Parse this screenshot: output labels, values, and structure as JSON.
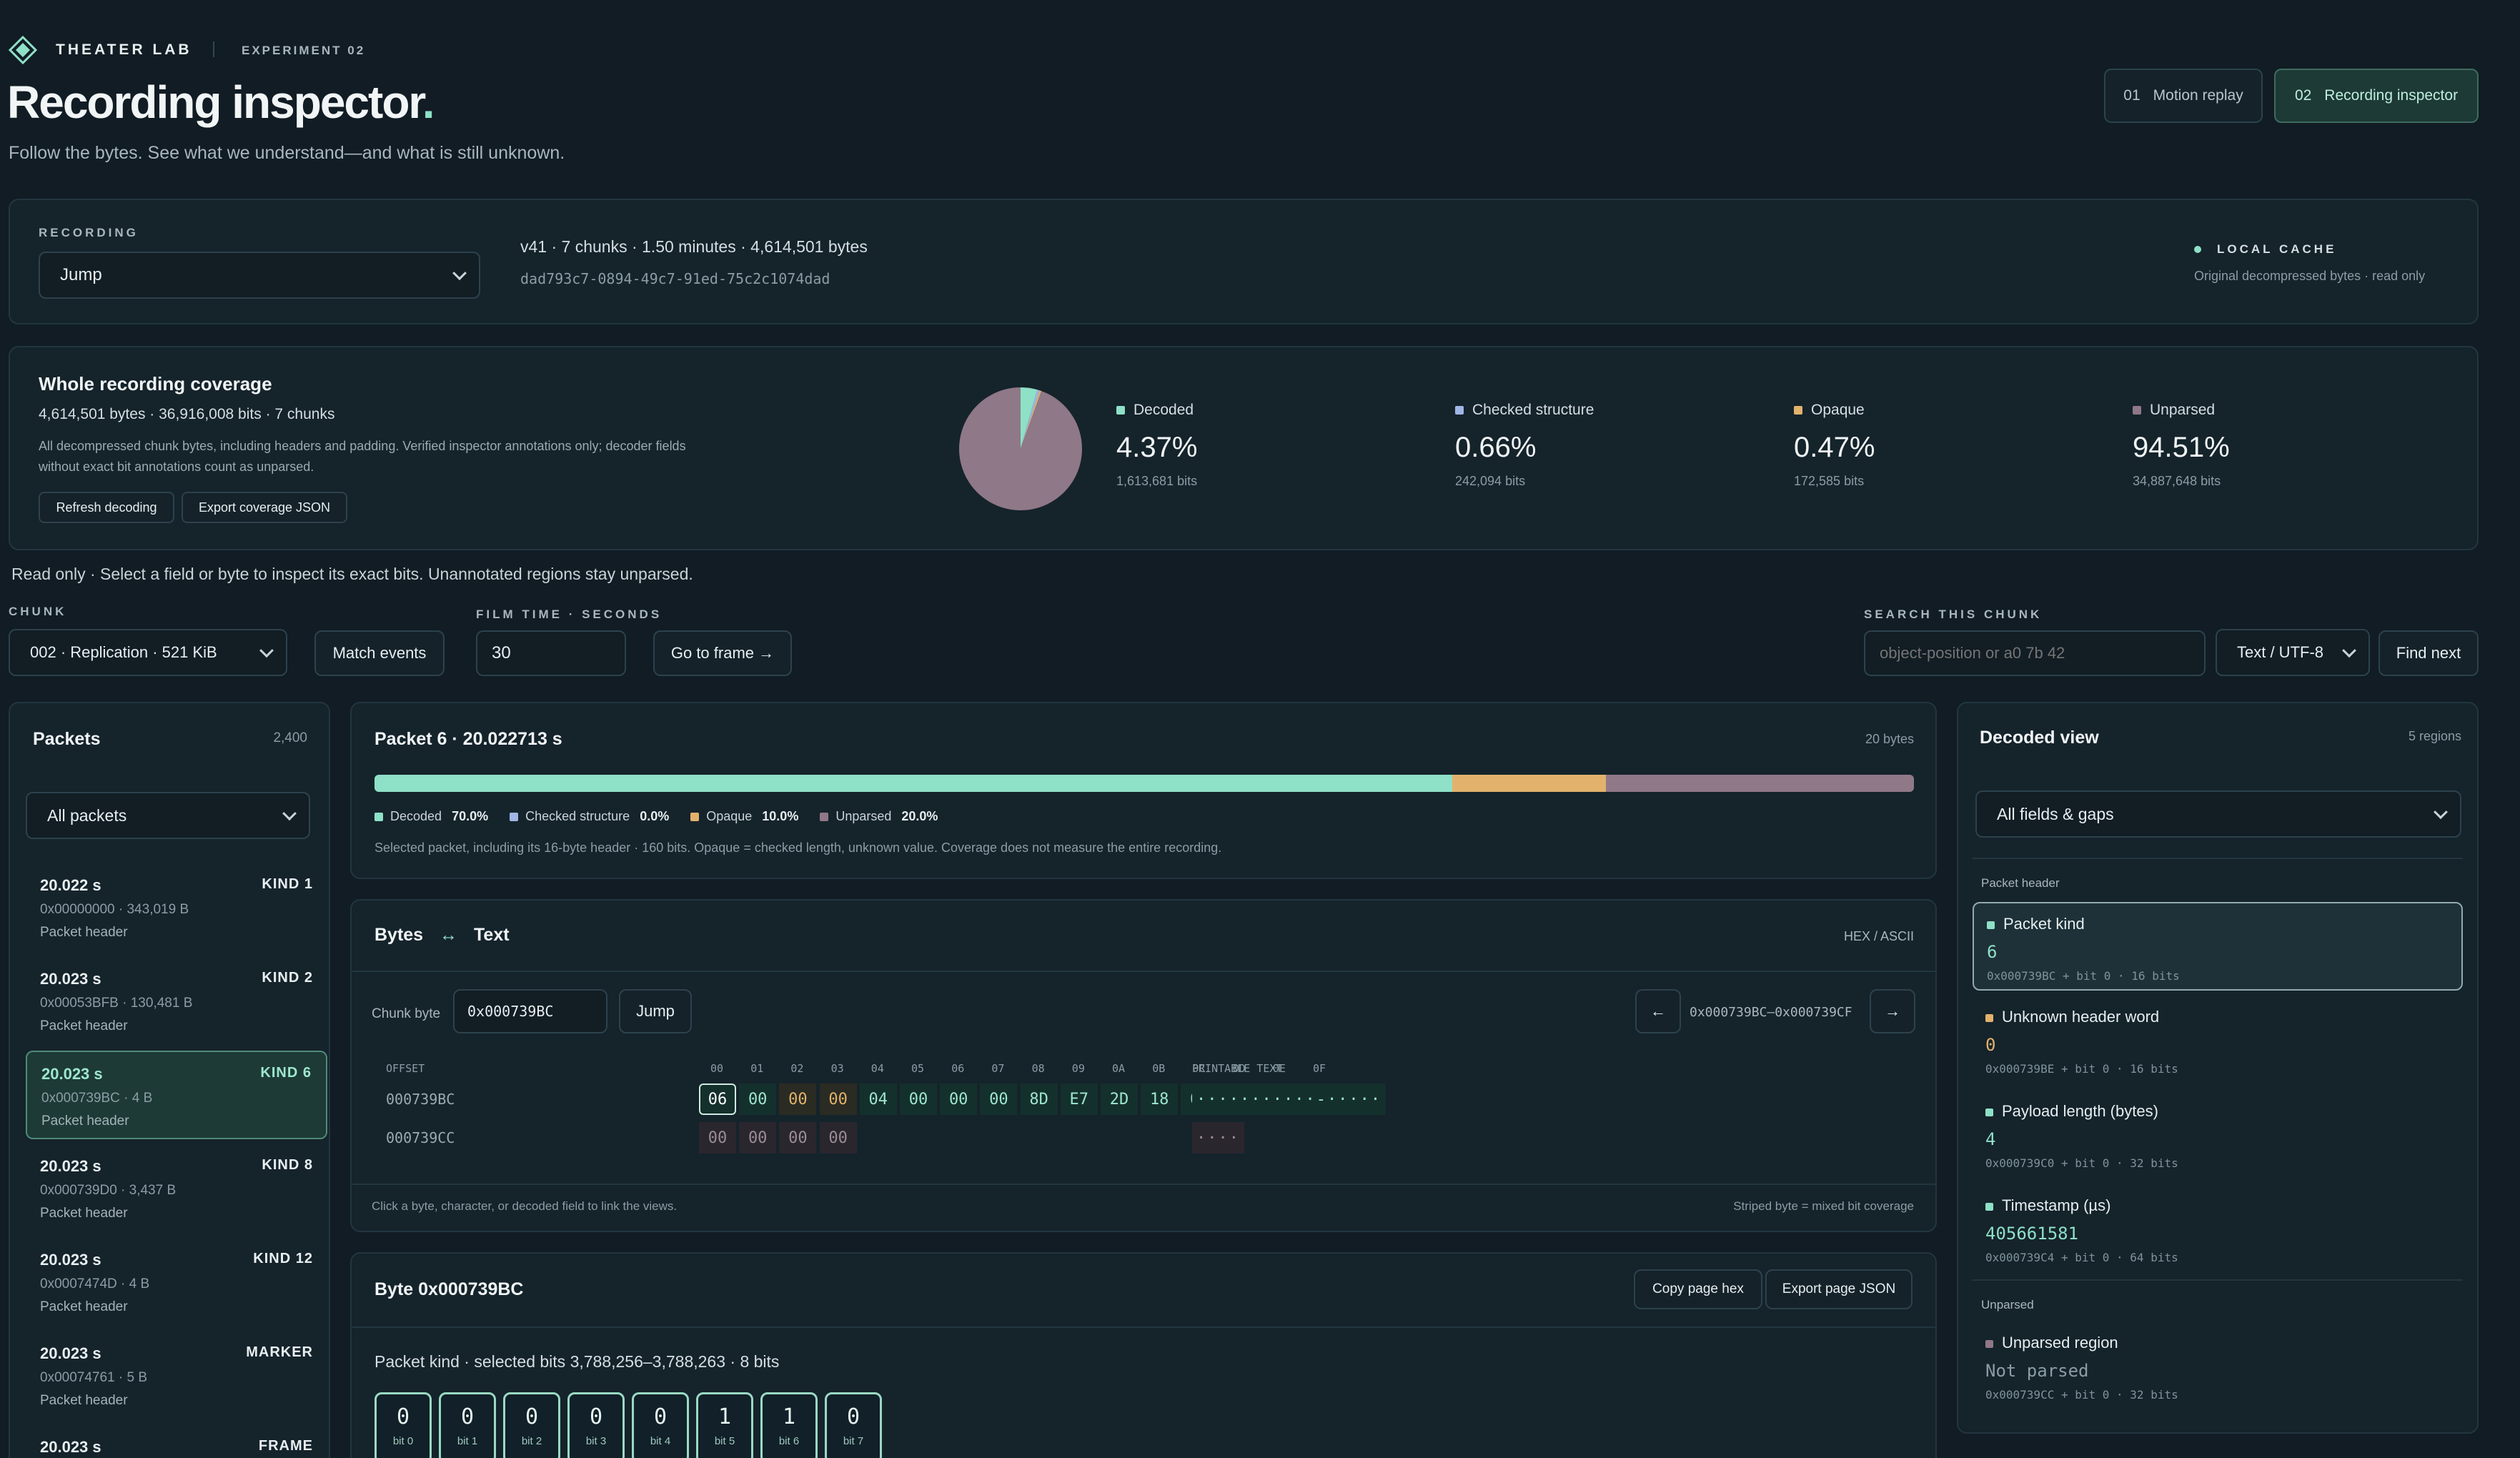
{
  "brand": {
    "name": "THEATER LAB",
    "experiment": "EXPERIMENT 02"
  },
  "page": {
    "title": "Recording inspector",
    "title_dot": ".",
    "subtitle": "Follow the bytes. See what we understand—and what is still unknown."
  },
  "nav_tabs": [
    {
      "num": "01",
      "label": "Motion replay",
      "active": false
    },
    {
      "num": "02",
      "label": "Recording inspector",
      "active": true
    }
  ],
  "recording": {
    "label": "RECORDING",
    "selected": "Jump",
    "meta": "v41 · 7 chunks · 1.50 minutes · 4,614,501 bytes",
    "uuid": "dad793c7-0894-49c7-91ed-75c2c1074dad",
    "cache_label": "LOCAL CACHE",
    "cache_note": "Original decompressed bytes · read only"
  },
  "coverage": {
    "title": "Whole recording coverage",
    "summary": "4,614,501 bytes · 36,916,008 bits · 7 chunks",
    "note1": "All decompressed chunk bytes, including headers and padding. Verified inspector annotations only; decoder fields",
    "note2": "without exact bit annotations count as unparsed.",
    "refresh_btn": "Refresh decoding",
    "export_btn": "Export coverage JSON",
    "stats": [
      {
        "name": "Decoded",
        "pct": "4.37%",
        "bits": "1,613,681 bits",
        "color": "#8ee0c6",
        "value": 4.37
      },
      {
        "name": "Checked structure",
        "pct": "0.66%",
        "bits": "242,094 bits",
        "color": "#9fb6e6",
        "value": 0.66
      },
      {
        "name": "Opaque",
        "pct": "0.47%",
        "bits": "172,585 bits",
        "color": "#e2b26c",
        "value": 0.47
      },
      {
        "name": "Unparsed",
        "pct": "94.51%",
        "bits": "34,887,648 bits",
        "color": "#8f7887",
        "value": 94.51
      }
    ]
  },
  "readonly_note": "Read only · Select a field or byte to inspect its exact bits. Unannotated regions stay unparsed.",
  "controls": {
    "chunk_label": "CHUNK",
    "chunk_value": "002 · Replication · 521 KiB",
    "match_events": "Match events",
    "film_label": "FILM TIME · SECONDS",
    "film_value": "30",
    "go_frame": "Go to frame →",
    "search_label": "SEARCH THIS CHUNK",
    "search_placeholder": "object-position or a0 7b 42",
    "encoding": "Text / UTF-8",
    "find_next": "Find next"
  },
  "packets": {
    "title": "Packets",
    "count": "2,400",
    "filter": "All packets",
    "items": [
      {
        "time": "20.022 s",
        "kind": "KIND 1",
        "addr": "0x00000000 · 343,019 B",
        "desc": "Packet header",
        "selected": false
      },
      {
        "time": "20.023 s",
        "kind": "KIND 2",
        "addr": "0x00053BFB · 130,481 B",
        "desc": "Packet header",
        "selected": false
      },
      {
        "time": "20.023 s",
        "kind": "KIND 6",
        "addr": "0x000739BC · 4 B",
        "desc": "Packet header",
        "selected": true
      },
      {
        "time": "20.023 s",
        "kind": "KIND 8",
        "addr": "0x000739D0 · 3,437 B",
        "desc": "Packet header",
        "selected": false
      },
      {
        "time": "20.023 s",
        "kind": "KIND 12",
        "addr": "0x0007474D · 4 B",
        "desc": "Packet header",
        "selected": false
      },
      {
        "time": "20.023 s",
        "kind": "MARKER",
        "addr": "0x00074761 · 5 B",
        "desc": "Packet header",
        "selected": false
      },
      {
        "time": "20.023 s",
        "kind": "FRAME",
        "addr": "",
        "desc": "",
        "selected": false
      }
    ]
  },
  "packet_detail": {
    "title": "Packet 6 · 20.022713 s",
    "size": "20 bytes",
    "legend": [
      {
        "name": "Decoded",
        "pct": "70.0%",
        "value": 70.0,
        "color": "#8ee0c6"
      },
      {
        "name": "Checked structure",
        "pct": "0.0%",
        "value": 0.0,
        "color": "#9fb6e6"
      },
      {
        "name": "Opaque",
        "pct": "10.0%",
        "value": 10.0,
        "color": "#e2b26c"
      },
      {
        "name": "Unparsed",
        "pct": "20.0%",
        "value": 20.0,
        "color": "#8f7887"
      }
    ],
    "note": "Selected packet, including its 16-byte header · 160 bits. Opaque = checked length, unknown value. Coverage does not measure the entire recording."
  },
  "bytes_view": {
    "title_left": "Bytes",
    "title_sym": "↔",
    "title_right": "Text",
    "mode": "HEX / ASCII",
    "chunk_byte_label": "Chunk byte",
    "chunk_byte_value": "0x000739BC",
    "jump": "Jump",
    "range": "0x000739BC–0x000739CF",
    "prev": "←",
    "next": "→",
    "offset_header": "OFFSET",
    "columns": [
      "00",
      "01",
      "02",
      "03",
      "04",
      "05",
      "06",
      "07",
      "08",
      "09",
      "0A",
      "0B",
      "0C",
      "0D",
      "0E",
      "0F"
    ],
    "printable_header": "PRINTABLE TEXT",
    "rows": [
      {
        "offset": "000739BC",
        "bytes": [
          "06",
          "00",
          "00",
          "00",
          "04",
          "00",
          "00",
          "00",
          "8D",
          "E7",
          "2D",
          "18",
          "00",
          "00",
          "00",
          "00"
        ],
        "text": "···········-·····"
      },
      {
        "offset": "000739CC",
        "bytes": [
          "00",
          "00",
          "00",
          "00"
        ],
        "text": "····"
      }
    ],
    "footer_left": "Click a byte, character, or decoded field to link the views.",
    "footer_right": "Striped byte = mixed bit coverage"
  },
  "byte_detail": {
    "title": "Byte 0x000739BC",
    "copy_hex": "Copy page hex",
    "export_json": "Export page JSON",
    "selection": "Packet kind · selected bits 3,788,256–3,788,263 · 8 bits",
    "bits": [
      {
        "v": "0",
        "l": "bit 0"
      },
      {
        "v": "0",
        "l": "bit 1"
      },
      {
        "v": "0",
        "l": "bit 2"
      },
      {
        "v": "0",
        "l": "bit 3"
      },
      {
        "v": "0",
        "l": "bit 4"
      },
      {
        "v": "1",
        "l": "bit 5"
      },
      {
        "v": "1",
        "l": "bit 6"
      },
      {
        "v": "0",
        "l": "bit 7"
      }
    ]
  },
  "decoded_view": {
    "title": "Decoded view",
    "count": "5 regions",
    "filter": "All fields & gaps",
    "group1": "Packet header",
    "group2": "Unparsed",
    "fields": [
      {
        "name": "Packet kind",
        "value": "6",
        "loc": "0x000739BC + bit 0 · 16 bits",
        "color": "#8ee0c6",
        "selected": true
      },
      {
        "name": "Unknown header word",
        "value": "0",
        "loc": "0x000739BE + bit 0 · 16 bits",
        "color": "#e2b26c",
        "selected": false
      },
      {
        "name": "Payload length (bytes)",
        "value": "4",
        "loc": "0x000739C0 + bit 0 · 32 bits",
        "color": "#8ee0c6",
        "selected": false
      },
      {
        "name": "Timestamp (µs)",
        "value": "405661581",
        "loc": "0x000739C4 + bit 0 · 64 bits",
        "color": "#8ee0c6",
        "selected": false
      }
    ],
    "unparsed": {
      "name": "Unparsed region",
      "value": "Not parsed",
      "loc": "0x000739CC + bit 0 · 32 bits",
      "color": "#8f7887"
    }
  }
}
